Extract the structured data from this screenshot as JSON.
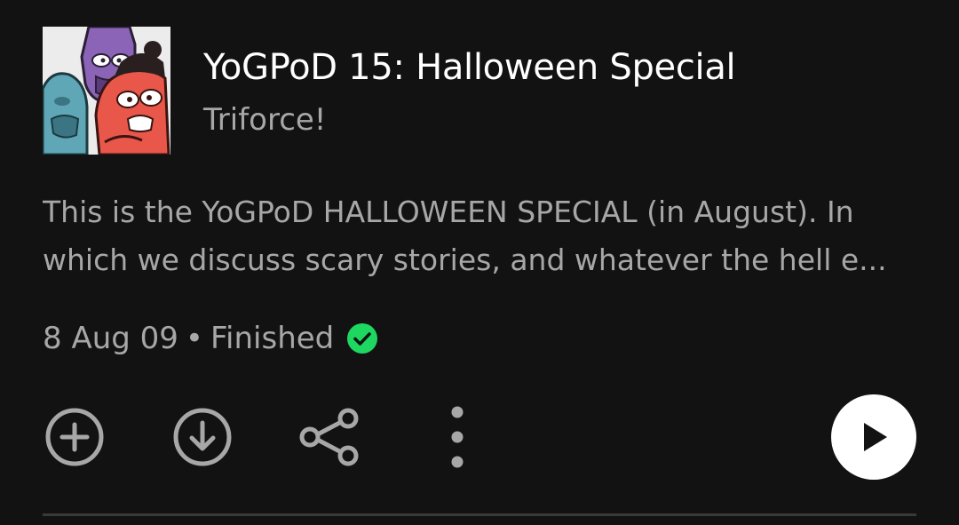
{
  "episode": {
    "title": "YoGPoD 15: Halloween Special",
    "show": "Triforce!",
    "description": "This is the YoGPoD HALLOWEEN SPECIAL (in August). In which we discuss scary stories, and whatever the hell e...",
    "date": "8 Aug 09",
    "separator": "•",
    "status": "Finished"
  },
  "icons": {
    "add": "plus-circle-icon",
    "download": "download-circle-icon",
    "share": "share-icon",
    "more": "more-vertical-icon",
    "play": "play-icon",
    "finished": "check-circle-icon"
  },
  "colors": {
    "background": "#121212",
    "title": "#ffffff",
    "secondary_text": "#a7a7a7",
    "icon": "#a7a7a7",
    "finished_green": "#1ed760",
    "play_button": "#ffffff",
    "divider": "#3a3a3a"
  }
}
